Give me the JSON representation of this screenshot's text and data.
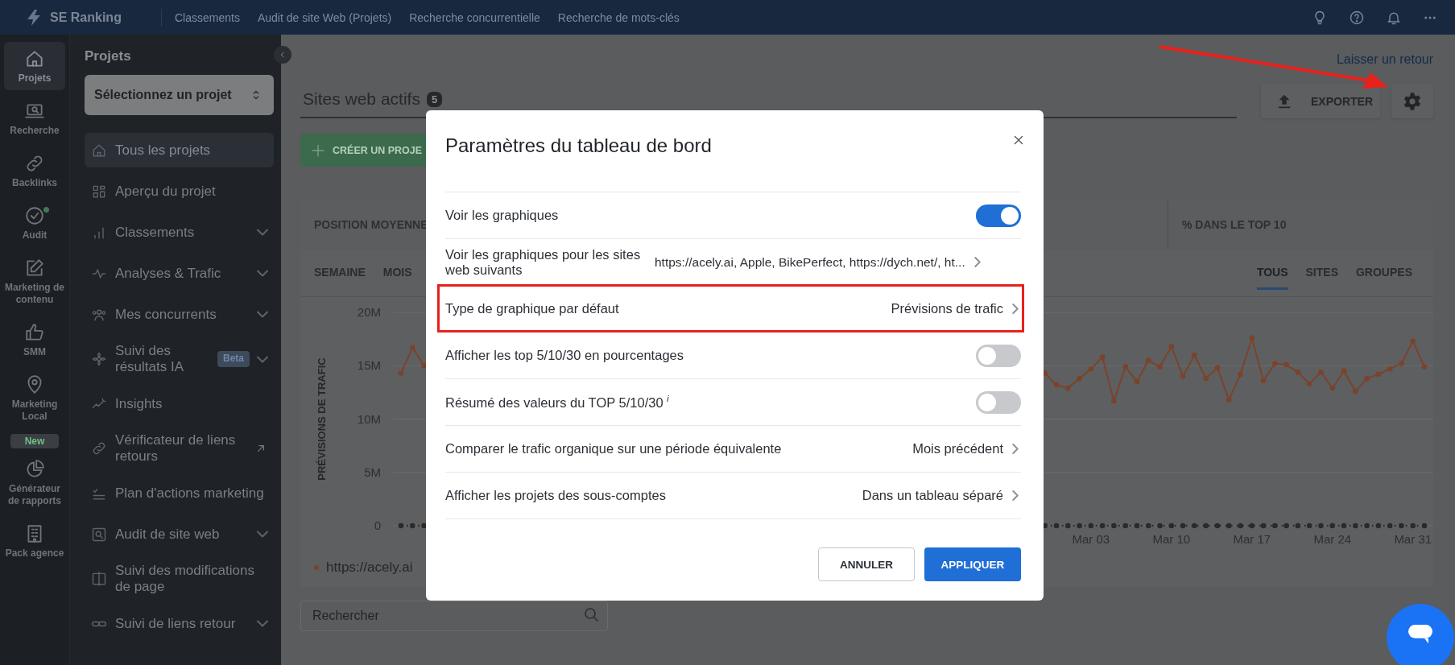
{
  "top_bar": {
    "logo": "SE Ranking",
    "nav": [
      "Classements",
      "Audit de site Web (Projets)",
      "Recherche concurrentielle",
      "Recherche de mots-clés"
    ]
  },
  "rail": {
    "items": [
      {
        "label": "Projets",
        "selected": true,
        "dot": false
      },
      {
        "label": "Recherche",
        "selected": false,
        "dot": false
      },
      {
        "label": "Backlinks",
        "selected": false,
        "dot": false
      },
      {
        "label": "Audit",
        "selected": false,
        "dot": true
      },
      {
        "label": "Marketing de contenu",
        "selected": false,
        "dot": false
      },
      {
        "label": "SMM",
        "selected": false,
        "dot": false
      },
      {
        "label": "Marketing Local",
        "selected": false,
        "dot": false,
        "badge": "New"
      },
      {
        "label": "Générateur de rapports",
        "selected": false,
        "dot": false
      },
      {
        "label": "Pack agence",
        "selected": false,
        "dot": false
      }
    ]
  },
  "sidebar": {
    "title": "Projets",
    "project_select": {
      "label": "Sélectionnez un projet"
    },
    "items": [
      {
        "label": "Tous les projets",
        "selected": true,
        "submenu": false,
        "external": false
      },
      {
        "label": "Aperçu du projet",
        "selected": false,
        "submenu": false,
        "external": false
      },
      {
        "label": "Classements",
        "selected": false,
        "submenu": true,
        "external": false
      },
      {
        "label": "Analyses & Trafic",
        "selected": false,
        "submenu": true,
        "external": false
      },
      {
        "label": "Mes concurrents",
        "selected": false,
        "submenu": true,
        "external": false
      },
      {
        "label": "Suivi des résultats IA",
        "selected": false,
        "submenu": true,
        "external": false,
        "badge": "Beta"
      },
      {
        "label": "Insights",
        "selected": false,
        "submenu": false,
        "external": false
      },
      {
        "label": "Vérificateur de liens retours",
        "selected": false,
        "submenu": false,
        "external": true
      },
      {
        "label": "Plan d'actions marketing",
        "selected": false,
        "submenu": false,
        "external": false
      },
      {
        "label": "Audit de site web",
        "selected": false,
        "submenu": true,
        "external": false
      },
      {
        "label": "Suivi des modifications de page",
        "selected": false,
        "submenu": false,
        "external": false
      },
      {
        "label": "Suivi de liens retour",
        "selected": false,
        "submenu": true,
        "external": false
      }
    ]
  },
  "main": {
    "feedback_link": "Laisser un retour",
    "tab": {
      "label": "Sites web actifs",
      "count": "5",
      "selected": true
    },
    "export_button": "EXPORTER",
    "create_button": "CRÉER UN PROJE",
    "stats": [
      "POSITION MOYENNE",
      "% DANS LE TOP 10"
    ],
    "period_tabs": [
      {
        "label": "SEMAINE",
        "selected": false
      },
      {
        "label": "MOIS",
        "selected": false
      }
    ],
    "view_tabs": [
      {
        "label": "TOUS",
        "selected": true
      },
      {
        "label": "SITES",
        "selected": false
      },
      {
        "label": "GROUPES",
        "selected": false
      }
    ],
    "chart_data": {
      "type": "line",
      "ylabel": "PRÉVISIONS DE TRAFIC",
      "grid": true,
      "ylim": [
        0,
        20
      ],
      "categories": [
        null,
        null,
        null,
        null,
        null,
        null,
        null,
        null,
        null,
        null,
        null,
        null,
        null,
        null,
        null,
        null,
        null,
        null,
        null,
        null,
        null,
        null,
        null,
        null,
        null,
        null,
        null,
        null,
        null,
        null,
        null,
        null,
        null,
        null,
        null,
        null,
        null,
        null,
        null,
        null,
        null,
        null,
        null,
        null,
        null,
        null,
        null,
        null,
        null,
        null,
        null,
        null,
        null,
        null,
        null,
        null,
        null,
        null,
        null,
        null,
        "Mar 03",
        null,
        null,
        null,
        null,
        null,
        null,
        "Mar 10",
        null,
        null,
        null,
        null,
        null,
        null,
        "Mar 17",
        null,
        null,
        null,
        null,
        null,
        null,
        "Mar 24",
        null,
        null,
        null,
        null,
        null,
        null,
        "Mar 31",
        null
      ],
      "yticks": [
        {
          "value": 0,
          "label": "0"
        },
        {
          "value": 5,
          "label": "5M"
        },
        {
          "value": 10,
          "label": "10M"
        },
        {
          "value": 15,
          "label": "15M"
        },
        {
          "value": 20,
          "label": "20M"
        }
      ],
      "series": [
        {
          "name": "https://acely.ai",
          "color": "#7b432b",
          "line_style": "solid",
          "marker": "circle",
          "values": [
            14.3,
            16.7,
            15.0,
            null,
            null,
            null,
            null,
            null,
            null,
            null,
            null,
            null,
            null,
            null,
            null,
            null,
            null,
            null,
            null,
            null,
            null,
            null,
            null,
            null,
            null,
            null,
            null,
            null,
            null,
            null,
            null,
            null,
            null,
            null,
            null,
            null,
            null,
            null,
            null,
            null,
            null,
            null,
            null,
            null,
            null,
            null,
            null,
            null,
            null,
            null,
            null,
            null,
            null,
            null,
            null,
            null,
            14.3,
            13.2,
            12.9,
            13.8,
            14.7,
            15.8,
            11.7,
            14.9,
            13.5,
            15.5,
            14.9,
            16.8,
            14.0,
            16.0,
            13.8,
            14.8,
            11.8,
            14.2,
            17.6,
            13.6,
            15.2,
            15.1,
            14.4,
            13.3,
            14.4,
            12.9,
            14.5,
            12.6,
            13.8,
            14.2,
            14.7,
            15.2,
            17.3,
            14.9
          ]
        },
        {
          "color": "#2a2a2a",
          "line_style": "dotted",
          "marker": "circle",
          "values": [
            0,
            0,
            0,
            null,
            null,
            null,
            null,
            null,
            null,
            null,
            null,
            null,
            null,
            null,
            null,
            null,
            null,
            null,
            null,
            null,
            null,
            null,
            null,
            null,
            null,
            null,
            null,
            null,
            null,
            null,
            null,
            null,
            null,
            null,
            null,
            null,
            null,
            null,
            null,
            null,
            null,
            null,
            null,
            null,
            null,
            null,
            null,
            null,
            null,
            null,
            null,
            null,
            null,
            null,
            null,
            null,
            0,
            0,
            0,
            0,
            0,
            0,
            0,
            0,
            0,
            0,
            0,
            0,
            0,
            0,
            0,
            0,
            0,
            0,
            0,
            0,
            0,
            0,
            0,
            0,
            0,
            0,
            0,
            0,
            0,
            0,
            0,
            0,
            0,
            0
          ]
        }
      ]
    },
    "search": {
      "placeholder": "Rechercher"
    }
  },
  "modal": {
    "title": "Paramètres du tableau de bord",
    "rows": [
      {
        "kind": "toggle",
        "label": "Voir les graphiques",
        "on": true
      },
      {
        "kind": "select",
        "label": "Voir les graphiques pour les sites web suivants",
        "value": "https://acely.ai, Apple, BikePerfect, https://dych.net/, ht..."
      },
      {
        "kind": "select",
        "label": "Type de graphique par défaut",
        "value": "Prévisions de trafic",
        "highlighted": true
      },
      {
        "kind": "toggle",
        "label": "Afficher les top 5/10/30 en pourcentages",
        "on": false
      },
      {
        "kind": "toggle",
        "label": "Résumé des valeurs du TOP 5/10/30 $^{i}$",
        "on": false
      },
      {
        "kind": "select",
        "label": "Comparer le trafic organique sur une période équivalente",
        "value": "Mois précédent"
      },
      {
        "kind": "select",
        "label": "Afficher les projets des sous-comptes",
        "value": "Dans un tableau séparé"
      }
    ],
    "buttons": [
      {
        "label": "ANNULER",
        "kind": "secondary"
      },
      {
        "label": "APPLIQUER",
        "kind": "primary"
      }
    ]
  }
}
